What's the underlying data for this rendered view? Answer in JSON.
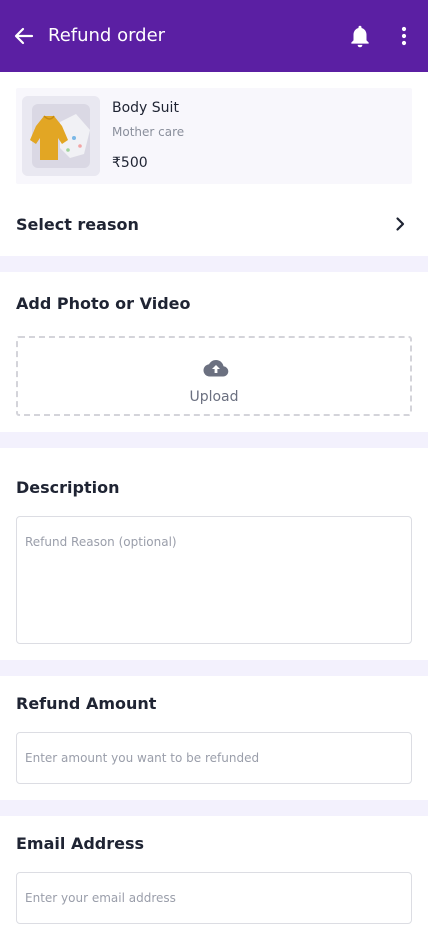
{
  "header": {
    "title": "Refund order",
    "back_icon": "arrow-left-icon",
    "bell_icon": "bell-icon",
    "menu_icon": "more-vertical-icon",
    "background_color": "#5b1fa3"
  },
  "product": {
    "name": "Body Suit",
    "category": "Mother care",
    "price": "₹500"
  },
  "reason": {
    "label": "Select reason",
    "chevron_icon": "chevron-right-icon"
  },
  "media": {
    "title": "Add Photo or Video",
    "upload_label": "Upload",
    "upload_icon": "cloud-upload-icon"
  },
  "description": {
    "title": "Description",
    "placeholder": "Refund Reason (optional)",
    "value": ""
  },
  "amount": {
    "title": "Refund Amount",
    "placeholder": "Enter amount you want to be refunded",
    "value": ""
  },
  "email": {
    "title": "Email Address",
    "placeholder": "Enter your email address",
    "value": ""
  }
}
